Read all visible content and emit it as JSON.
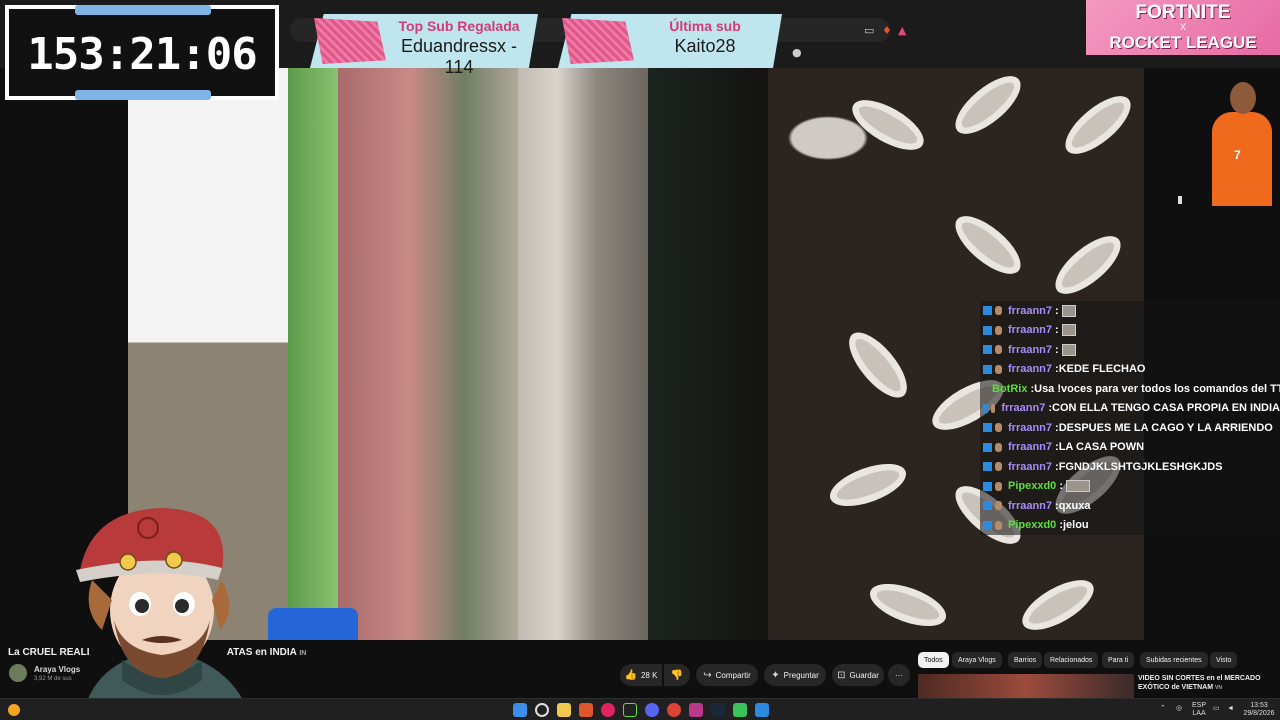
{
  "overlay": {
    "timer": "153:21:06",
    "top_sub_label": "Top Sub Regalada",
    "top_sub_value": "Eduandressx - 114",
    "last_sub_label": "Última sub",
    "last_sub_value": "Kaito28",
    "promo_line1": "FORTNITE",
    "promo_line2": "X",
    "promo_line3": "ROCKET LEAGUE",
    "jersey_number": "7"
  },
  "chat": {
    "messages": [
      {
        "user": "frraann7",
        "user_color": "#a78bfa",
        "text": "",
        "emote": "small"
      },
      {
        "user": "frraann7",
        "user_color": "#a78bfa",
        "text": "",
        "emote": "small"
      },
      {
        "user": "frraann7",
        "user_color": "#a78bfa",
        "text": "",
        "emote": "small"
      },
      {
        "user": "frraann7",
        "user_color": "#a78bfa",
        "text": "KEDE FLECHAO",
        "emote": ""
      },
      {
        "user": "BotRix",
        "user_color": "#5dde3a",
        "text": "Usa !voces para ver todos los comandos del TTS",
        "emote": ""
      },
      {
        "user": "frraann7",
        "user_color": "#a78bfa",
        "text": "CON ELLA TENGO CASA PROPIA EN INDIA",
        "emote": ""
      },
      {
        "user": "frraann7",
        "user_color": "#a78bfa",
        "text": "DESPUES ME LA CAGO Y LA ARRIENDO",
        "emote": ""
      },
      {
        "user": "frraann7",
        "user_color": "#a78bfa",
        "text": "LA CASA POWN",
        "emote": ""
      },
      {
        "user": "frraann7",
        "user_color": "#a78bfa",
        "text": "FGNDJKLSHTGJKLESHGKJDS",
        "emote": ""
      },
      {
        "user": "Pipexxd0",
        "user_color": "#5dde3a",
        "text": "",
        "emote": "wide"
      },
      {
        "user": "frraann7",
        "user_color": "#a78bfa",
        "text": "qxuxa",
        "emote": ""
      },
      {
        "user": "Pipexxd0",
        "user_color": "#5dde3a",
        "text": "jelou",
        "emote": ""
      }
    ]
  },
  "youtube": {
    "video_title_left": "La CRUEL REALI",
    "video_title_right": "ATAS en INDIA",
    "video_title_badge": "IN",
    "channel_name": "Araya Vlogs",
    "channel_subs": "3,92 M de sus",
    "like_count": "28 K",
    "share_label": "Compartir",
    "ask_label": "Preguntar",
    "save_label": "Guardar",
    "more_label": "···",
    "chips": [
      "Todos",
      "Araya Vlogs",
      "Barrios",
      "Relacionados",
      "Para ti",
      "Subidas recientes",
      "Visto"
    ],
    "rec_title": "VIDEO SIN CORTES en el MERCADO EXÓTICO de VIETNAM",
    "rec_badge": "VN"
  },
  "taskbar": {
    "lang_top": "ESP",
    "lang_bottom": "LAA",
    "time": "13:53",
    "date": "29/8/2026"
  },
  "colors": {
    "sub_banner_bg": "#bfe6ef",
    "sub_label": "#d43a77",
    "timer_accent": "#7fb5e6"
  }
}
